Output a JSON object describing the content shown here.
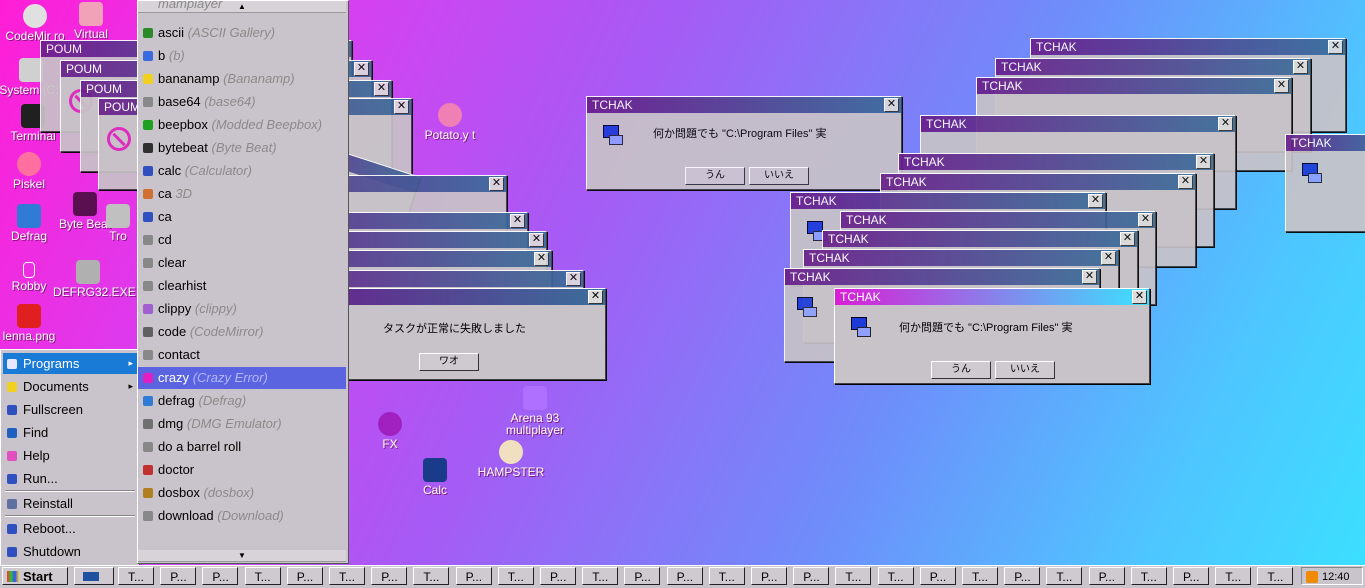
{
  "desktop_icons": [
    {
      "label": "CodeMir ro",
      "color": "#e0e0e0"
    },
    {
      "label": "Virtual",
      "color": "#f2a2b8"
    },
    {
      "label": "System (C:)",
      "color": "#d0d0d0"
    },
    {
      "label": "Terminal",
      "color": "#202020"
    },
    {
      "label": "Piskel",
      "color": "#ff70a0"
    },
    {
      "label": "Defrag",
      "color": "#2f7bd6"
    },
    {
      "label": "Byte Beat",
      "color": "#5a1050"
    },
    {
      "label": "Robby",
      "color": "#ffffff"
    },
    {
      "label": "DEFRG32.EXE",
      "color": "#b0b0b0"
    },
    {
      "label": "lenna.png",
      "color": "#e02020"
    },
    {
      "label": "Potato.y t",
      "color": "#f07fb5"
    },
    {
      "label": "Arena 93 multiplayer",
      "color": "#b070ff"
    },
    {
      "label": "FX",
      "color": "#a020c0"
    },
    {
      "label": "HAMPSTER",
      "color": "#f0e0c0"
    },
    {
      "label": "Calc",
      "color": "#1a3a8a"
    },
    {
      "label": "Tro",
      "color": "#c0c0c0"
    }
  ],
  "start_menu": {
    "items": [
      {
        "label": "Programs",
        "icon": "programs-icon",
        "has_submenu": true,
        "selected": true
      },
      {
        "label": "Documents",
        "icon": "documents-icon",
        "has_submenu": true
      },
      {
        "label": "Fullscreen",
        "icon": "fullscreen-icon"
      },
      {
        "label": "Find",
        "icon": "find-icon"
      },
      {
        "label": "Help",
        "icon": "help-icon"
      },
      {
        "label": "Run...",
        "icon": "run-icon"
      },
      {
        "label": "Reinstall",
        "icon": "reinstall-icon"
      },
      {
        "label": "Reboot...",
        "icon": "reboot-icon"
      },
      {
        "label": "Shutdown",
        "icon": "shutdown-icon"
      }
    ]
  },
  "programs_menu": {
    "items": [
      {
        "name": "ascii",
        "desc": "(ASCII Gallery)",
        "color": "#2a8a2a"
      },
      {
        "name": "b",
        "desc": "(b)",
        "color": "#3a6ae0"
      },
      {
        "name": "bananamp",
        "desc": "(Bananamp)",
        "color": "#f0d020"
      },
      {
        "name": "base64",
        "desc": "(base64)",
        "color": "#888888"
      },
      {
        "name": "beepbox",
        "desc": "(Modded Beepbox)",
        "color": "#20a020"
      },
      {
        "name": "bytebeat",
        "desc": "(Byte Beat)",
        "color": "#303030"
      },
      {
        "name": "calc",
        "desc": "(Calculator)",
        "color": "#3050c0"
      },
      {
        "name": "ca",
        "desc": "3D",
        "color": "#d07030"
      },
      {
        "name": "ca",
        "desc": "",
        "color": "#3050c0"
      },
      {
        "name": "cd",
        "desc": "",
        "color": "#888888"
      },
      {
        "name": "clear",
        "desc": "",
        "color": "#888888"
      },
      {
        "name": "clearhist",
        "desc": "",
        "color": "#888888"
      },
      {
        "name": "clippy",
        "desc": "(clippy)",
        "color": "#a060d0"
      },
      {
        "name": "code",
        "desc": "(CodeMirror)",
        "color": "#606060"
      },
      {
        "name": "contact",
        "desc": "",
        "color": "#888888"
      },
      {
        "name": "crazy",
        "desc": "(Crazy Error)",
        "color": "#e020c0",
        "selected": true
      },
      {
        "name": "defrag",
        "desc": "(Defrag)",
        "color": "#2f7bd6"
      },
      {
        "name": "dmg",
        "desc": "(DMG Emulator)",
        "color": "#707070"
      },
      {
        "name": "do a barrel roll",
        "desc": "",
        "color": "#888888"
      },
      {
        "name": "doctor",
        "desc": "",
        "color": "#c03030"
      },
      {
        "name": "dosbox",
        "desc": "(dosbox)",
        "color": "#b08020"
      },
      {
        "name": "download",
        "desc": "(Download)",
        "color": "#888888"
      }
    ],
    "top_partial": "mamplayer"
  },
  "error_dialog": {
    "title": "POUM",
    "message": "タスクが正常に失敗しました",
    "button": "ワオ",
    "close": "✕"
  },
  "tchak_dialog": {
    "title": "TCHAK",
    "message": "何か問題でも \"C:\\Program Files\" 実",
    "yes": "うん",
    "no": "いいえ",
    "close": "✕"
  },
  "taskbar": {
    "start_label": "Start",
    "buttons": [
      "T...",
      "P...",
      "P...",
      "T...",
      "P...",
      "T...",
      "P...",
      "T...",
      "P...",
      "T...",
      "P...",
      "T...",
      "P...",
      "P...",
      "T...",
      "P...",
      "P...",
      "T...",
      "T...",
      "P...",
      "T...",
      "P...",
      "T...",
      "P...",
      "T...",
      "P...",
      "T...",
      "T..."
    ],
    "clock": "12:40"
  },
  "colors": {
    "accent": "#1a7bd6",
    "selected_program": "#5a63e0",
    "title_start": "#6a1f8c",
    "title_end": "#3b6e9a",
    "error_icon": "#e020c0"
  }
}
